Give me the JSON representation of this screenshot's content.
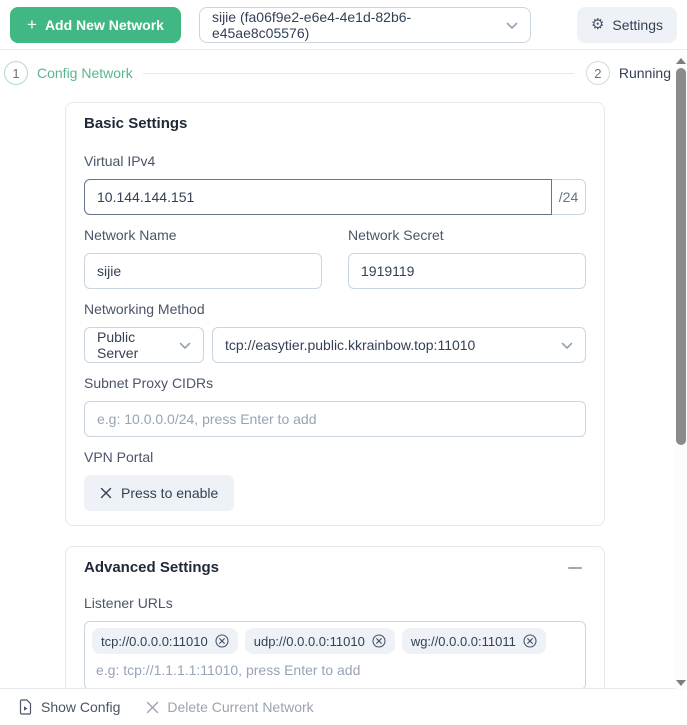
{
  "header": {
    "add_button": "Add New Network",
    "network_select": "sijie (fa06f9e2-e6e4-4e1d-82b6-e45ae8c05576)",
    "settings_button": "Settings"
  },
  "icons": {
    "plus": "+",
    "gear": "⚙"
  },
  "stepper": {
    "step1_number": "1",
    "step1_label": "Config Network",
    "step2_number": "2",
    "step2_label": "Running"
  },
  "basic": {
    "title": "Basic Settings",
    "virtual_ipv4_label": "Virtual IPv4",
    "virtual_ipv4_value": "10.144.144.151",
    "virtual_ipv4_suffix": "/24",
    "network_name_label": "Network Name",
    "network_name_value": "sijie",
    "network_secret_label": "Network Secret",
    "network_secret_value": "1919119",
    "networking_method_label": "Networking Method",
    "networking_method_value": "Public Server",
    "public_server_url": "tcp://easytier.public.kkrainbow.top:11010",
    "subnet_proxy_label": "Subnet Proxy CIDRs",
    "subnet_proxy_placeholder": "e.g: 10.0.0.0/24, press Enter to add",
    "vpn_portal_label": "VPN Portal",
    "vpn_portal_button": "Press to enable"
  },
  "advanced": {
    "title": "Advanced Settings",
    "listener_urls_label": "Listener URLs",
    "listeners": [
      "tcp://0.0.0.0:11010",
      "udp://0.0.0.0:11010",
      "wg://0.0.0.0:11011"
    ],
    "listener_placeholder": "e.g: tcp://1.1.1.1:11010, press Enter to add"
  },
  "footer": {
    "show_config": "Show Config",
    "delete_network": "Delete Current Network"
  },
  "colors": {
    "accent_green": "#41b883",
    "step_active_green": "#56b88b",
    "chip_background": "#eef2f6",
    "light_button_background": "#eef2f7",
    "input_border": "#cbd5e1",
    "focused_input_border": "#64748b"
  }
}
